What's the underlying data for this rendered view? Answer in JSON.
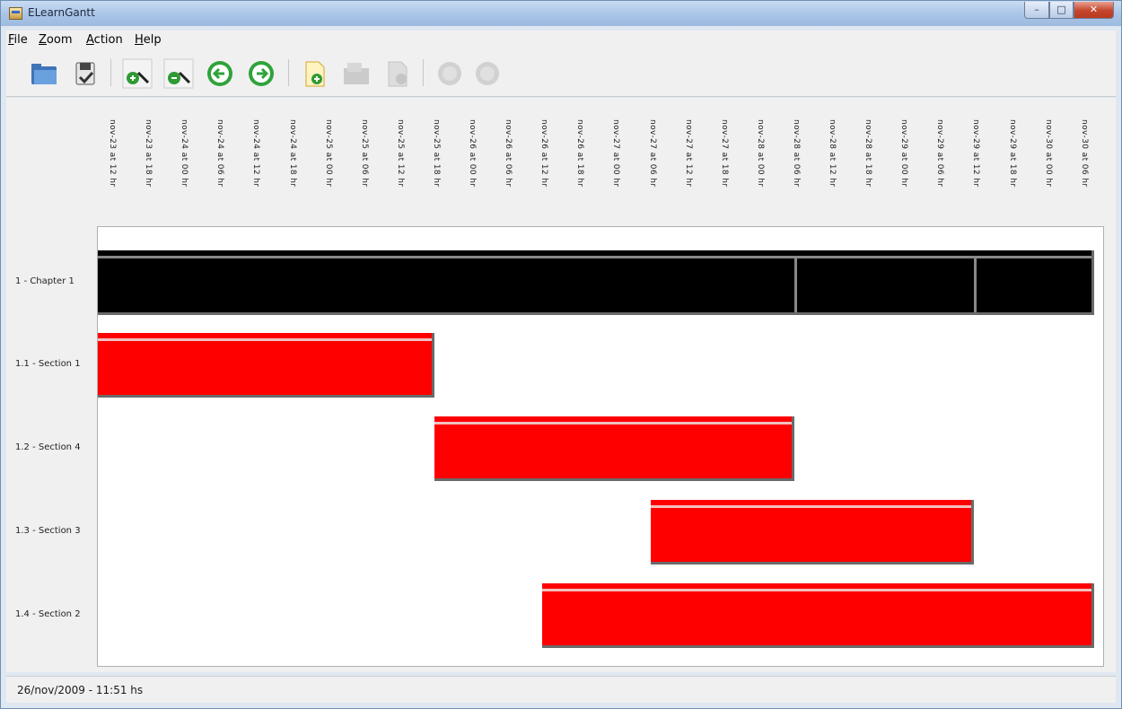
{
  "window": {
    "title": "ELearnGantt"
  },
  "menu": {
    "file": "ile",
    "file_mn": "F",
    "zoom": "oom",
    "zoom_mn": "Z",
    "action": "ction",
    "action_mn": "A",
    "help": "elp",
    "help_mn": "H"
  },
  "toolbar": {
    "buttons": [
      {
        "icon": "open-folder-icon",
        "enabled": true
      },
      {
        "icon": "save-icon",
        "enabled": true
      },
      {
        "icon": "zoom-in-icon",
        "enabled": true
      },
      {
        "icon": "zoom-out-icon",
        "enabled": true
      },
      {
        "icon": "arrow-left-icon",
        "enabled": true
      },
      {
        "icon": "arrow-right-icon",
        "enabled": true
      },
      {
        "icon": "new-document-icon",
        "enabled": true
      },
      {
        "icon": "open-document-icon",
        "enabled": false
      },
      {
        "icon": "document-save-icon",
        "enabled": false
      },
      {
        "icon": "circle-icon",
        "enabled": false
      },
      {
        "icon": "circle-icon",
        "enabled": false
      }
    ]
  },
  "gantt": {
    "time_ticks": [
      "nov-23 at 12 hr",
      "nov-23 at 18 hr",
      "nov-24 at 00 hr",
      "nov-24 at 06 hr",
      "nov-24 at 12 hr",
      "nov-24 at 18 hr",
      "nov-25 at 00 hr",
      "nov-25 at 06 hr",
      "nov-25 at 12 hr",
      "nov-25 at 18 hr",
      "nov-26 at 00 hr",
      "nov-26 at 06 hr",
      "nov-26 at 12 hr",
      "nov-26 at 18 hr",
      "nov-27 at 00 hr",
      "nov-27 at 06 hr",
      "nov-27 at 12 hr",
      "nov-27 at 18 hr",
      "nov-28 at 00 hr",
      "nov-28 at 06 hr",
      "nov-28 at 12 hr",
      "nov-28 at 18 hr",
      "nov-29 at 00 hr",
      "nov-29 at 06 hr",
      "nov-29 at 12 hr",
      "nov-29 at 18 hr",
      "nov-30 at 00 hr",
      "nov-30 at 06 hr"
    ],
    "tasks": [
      {
        "label": "1 - Chapter 1",
        "start": "nov-23 at 12 hr",
        "end": "nov-30 at 06 hr",
        "color": "#000000"
      },
      {
        "label": "1.1 - Section 1",
        "start": "nov-23 at 12 hr",
        "end": "nov-25 at 18 hr",
        "color": "#ff0000"
      },
      {
        "label": "1.2 - Section 4",
        "start": "nov-25 at 18 hr",
        "end": "nov-28 at 06 hr",
        "color": "#ff0000"
      },
      {
        "label": "1.3 - Section 3",
        "start": "nov-27 at 06 hr",
        "end": "nov-29 at 12 hr",
        "color": "#ff0000"
      },
      {
        "label": "1.4 - Section 2",
        "start": "nov-26 at 12 hr",
        "end": "nov-30 at 06 hr",
        "color": "#ff0000"
      }
    ]
  },
  "status": {
    "text": "26/nov/2009 - 11:51 hs"
  }
}
